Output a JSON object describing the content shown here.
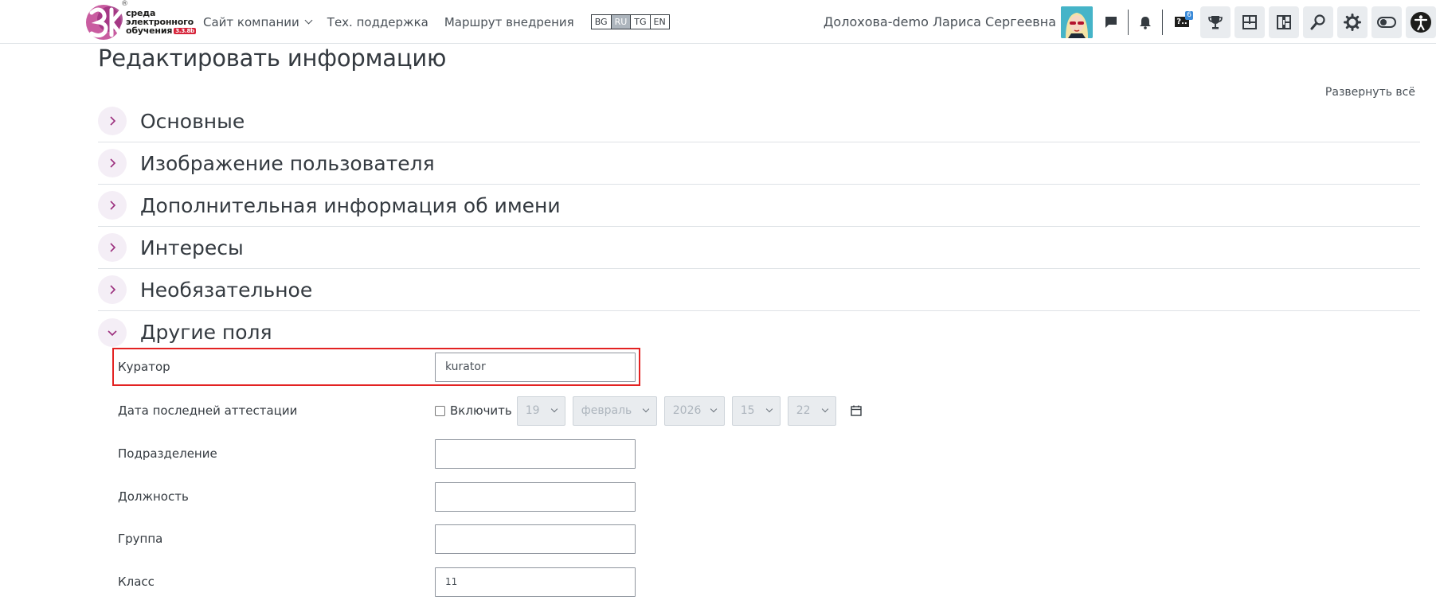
{
  "logo": {
    "line1": "среда",
    "line2": "электронного",
    "line3": "обучения",
    "version": "3.3.8b",
    "reg": "®"
  },
  "nav": {
    "items": [
      {
        "label": "Сайт компании"
      },
      {
        "label": "Тех. поддержка"
      },
      {
        "label": "Маршрут внедрения"
      }
    ],
    "languages": [
      "BG",
      "RU",
      "TG",
      "EN"
    ],
    "active_language": "RU"
  },
  "user": {
    "name": "Долохова-demo Лариса Сергеевна"
  },
  "toolbar": {
    "help_badge_text": "?..",
    "help_badge_count": "6",
    "icons": [
      "message-icon",
      "bell-icon",
      "help-badge-icon",
      "trophy-icon",
      "dashboard-icon",
      "board-icon",
      "search-icon",
      "gear-icon",
      "toggle-icon",
      "accessibility-icon"
    ],
    "accent": "#3b8bd9"
  },
  "page": {
    "title": "Редактировать информацию",
    "expand_all": "Развернуть всё"
  },
  "sections": [
    {
      "title": "Основные",
      "expanded": false
    },
    {
      "title": "Изображение пользователя",
      "expanded": false
    },
    {
      "title": "Дополнительная информация об имени",
      "expanded": false
    },
    {
      "title": "Интересы",
      "expanded": false
    },
    {
      "title": "Необязательное",
      "expanded": false
    },
    {
      "title": "Другие поля",
      "expanded": true
    }
  ],
  "fields": {
    "curator": {
      "label": "Куратор",
      "value": "kurator"
    },
    "last_attestation": {
      "label": "Дата последней аттестации",
      "enable_label": "Включить",
      "day": "19",
      "month": "февраль",
      "year": "2026",
      "hour": "15",
      "minute": "22"
    },
    "department": {
      "label": "Подразделение",
      "value": ""
    },
    "position": {
      "label": "Должность",
      "value": ""
    },
    "group": {
      "label": "Группа",
      "value": ""
    },
    "class": {
      "label": "Класс",
      "value": "11"
    }
  },
  "colors": {
    "highlight": "#e32222",
    "toggle_bg": "#f4eef6",
    "logo_pink": "#c0408f"
  }
}
